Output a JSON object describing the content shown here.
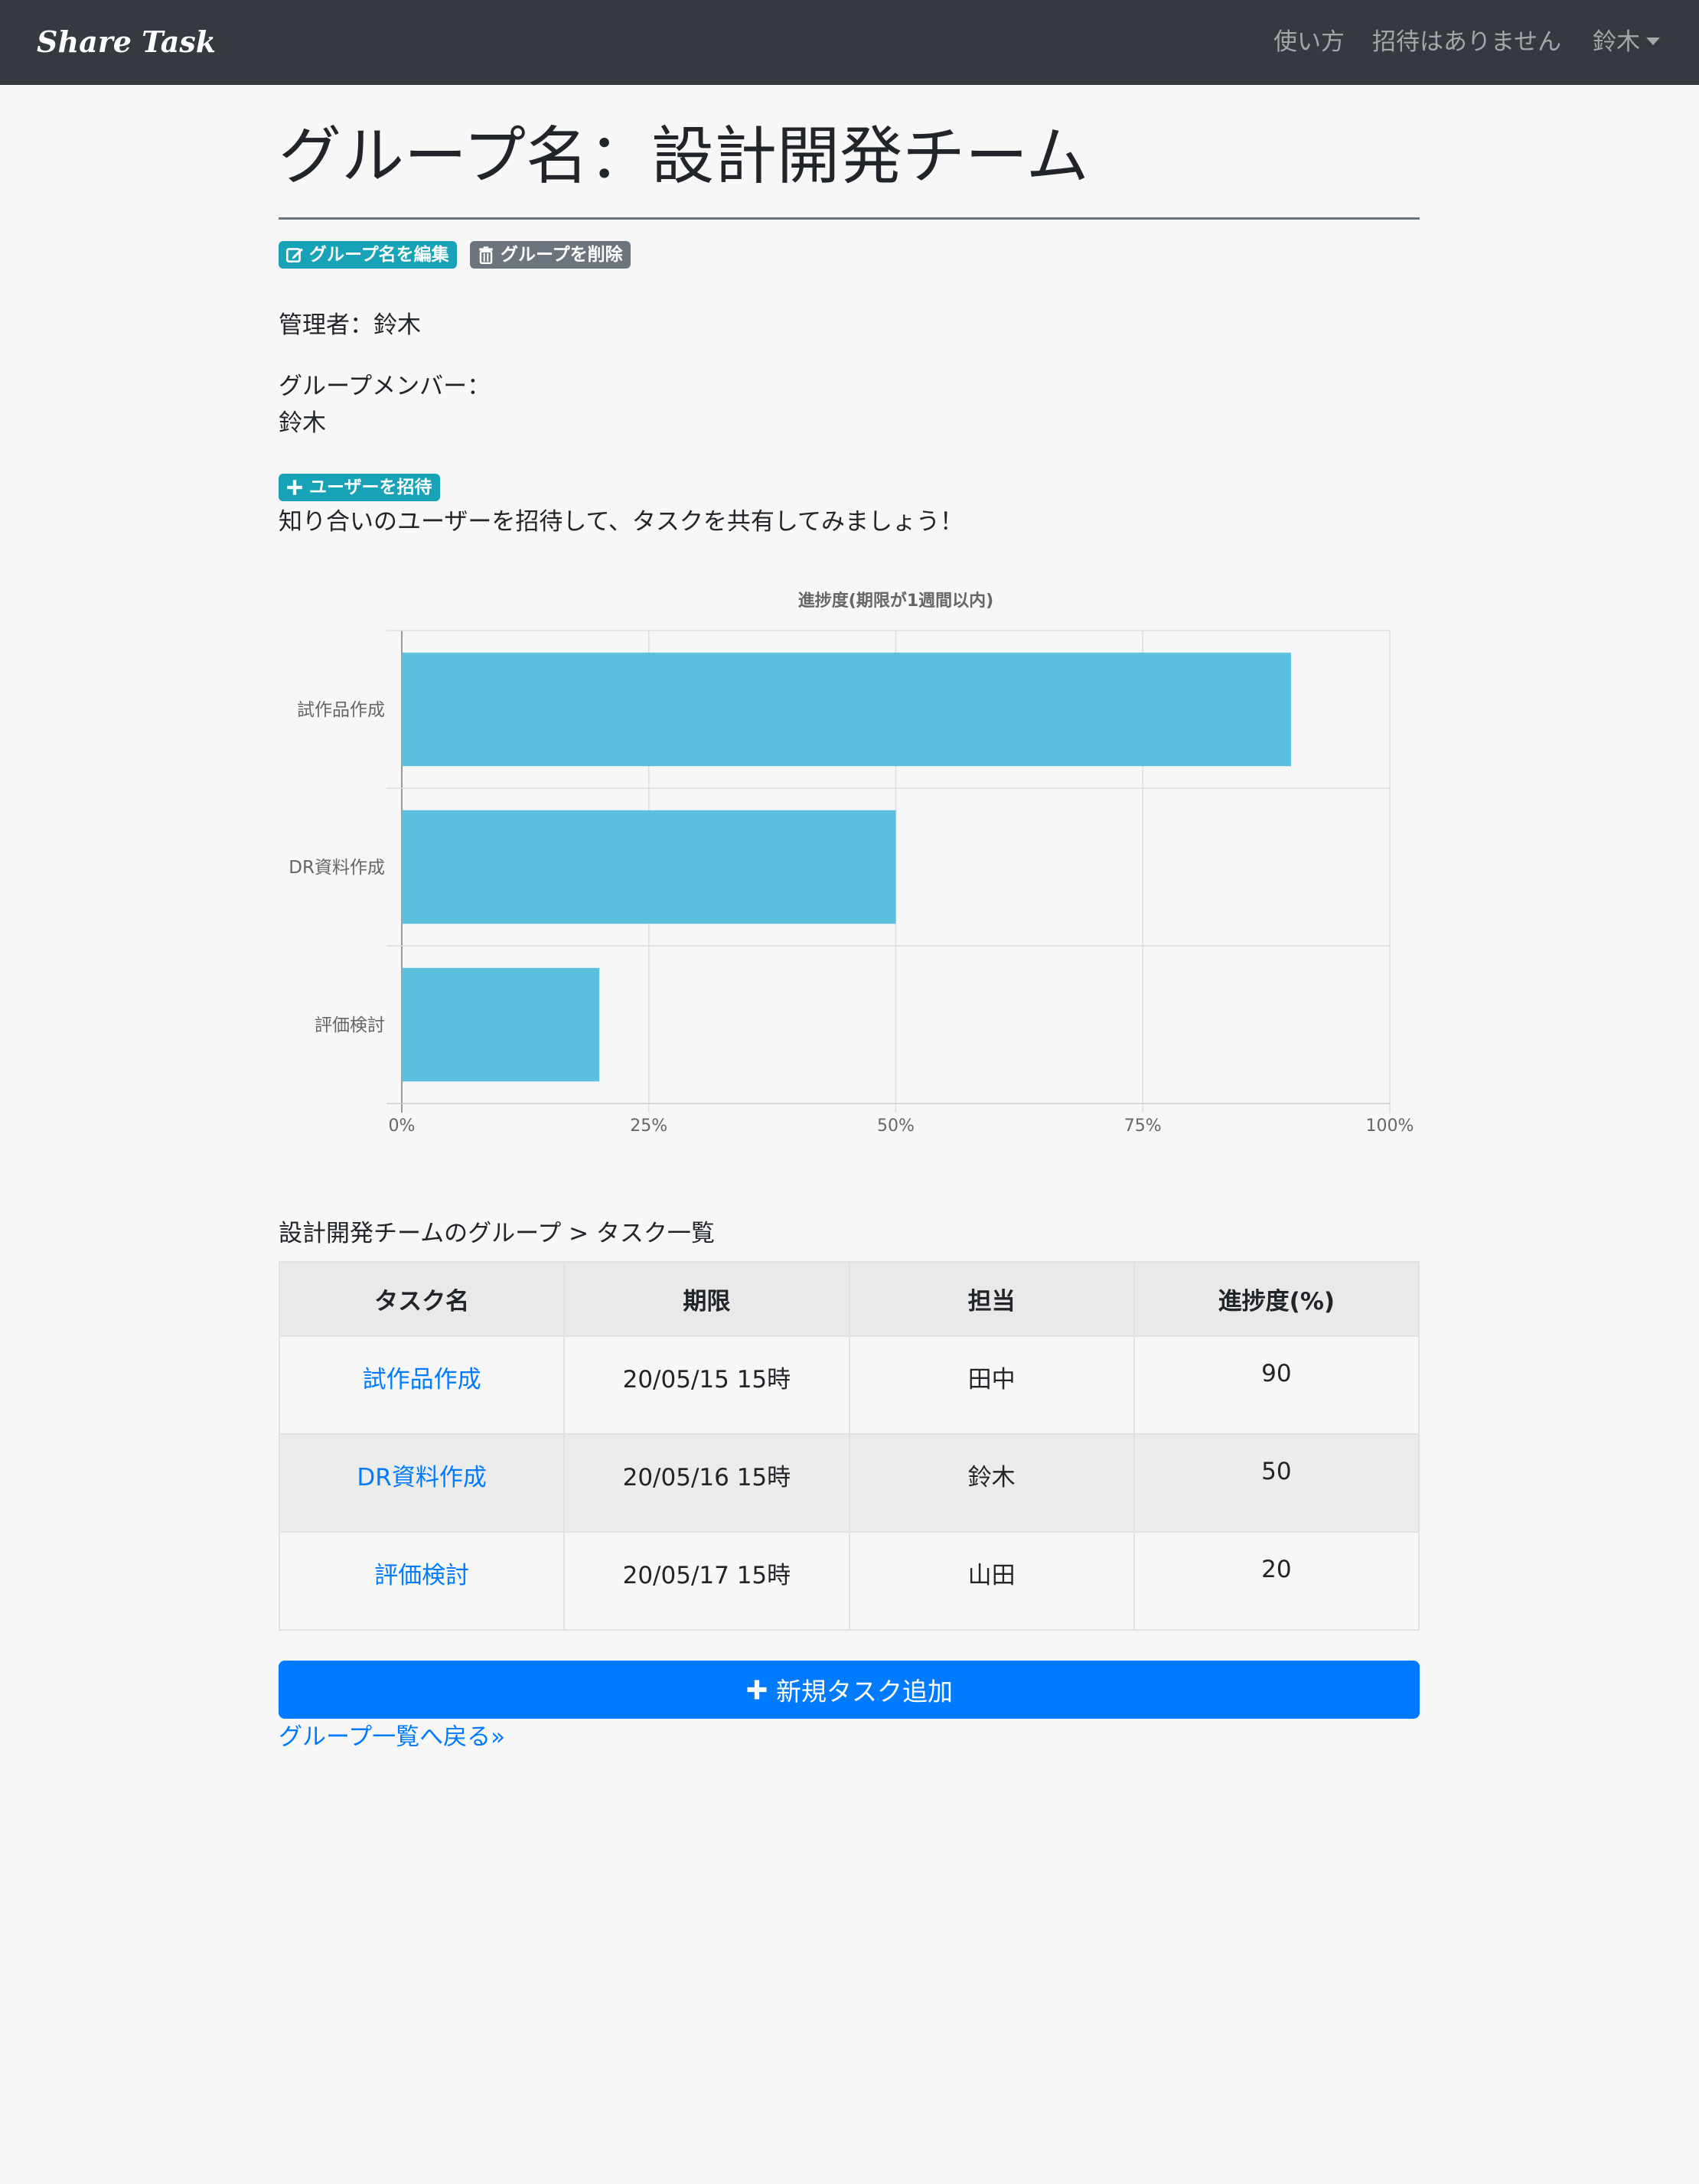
{
  "navbar": {
    "brand": "Share Task",
    "how_to": "使い方",
    "invitations": "招待はありません",
    "user": "鈴木"
  },
  "group": {
    "title": "グループ名：設計開発チーム",
    "edit_label": "グループ名を編集",
    "delete_label": "グループを削除",
    "admin_text": "管理者：鈴木",
    "members_label": "グループメンバー：",
    "members": [
      "鈴木"
    ],
    "invite_label": "ユーザーを招待",
    "invite_message": "知り合いのユーザーを招待して、タスクを共有してみましょう！"
  },
  "chart_data": {
    "type": "bar",
    "orientation": "horizontal",
    "title": "進捗度(期限が1週間以内)",
    "categories": [
      "試作品作成",
      "DR資料作成",
      "評価検討"
    ],
    "values": [
      90,
      50,
      20
    ],
    "xlim": [
      0,
      100
    ],
    "x_ticks": [
      "0%",
      "25%",
      "50%",
      "75%",
      "100%"
    ],
    "bar_color": "#5bc0de",
    "grid": true
  },
  "tasks": {
    "heading": "設計開発チームのグループ > タスク一覧",
    "columns": [
      "タスク名",
      "期限",
      "担当",
      "進捗度(%)"
    ],
    "rows": [
      {
        "name": "試作品作成",
        "deadline": "20/05/15 15時",
        "owner": "田中",
        "progress": "90"
      },
      {
        "name": "DR資料作成",
        "deadline": "20/05/16 15時",
        "owner": "鈴木",
        "progress": "50"
      },
      {
        "name": "評価検討",
        "deadline": "20/05/17 15時",
        "owner": "山田",
        "progress": "20"
      }
    ]
  },
  "actions": {
    "new_task": "新規タスク追加",
    "back_link": "グループ一覧へ戻る»"
  },
  "colors": {
    "navbar": "#343a40",
    "primary": "#007bff",
    "info": "#17a2b8",
    "secondary": "#6c757d"
  }
}
